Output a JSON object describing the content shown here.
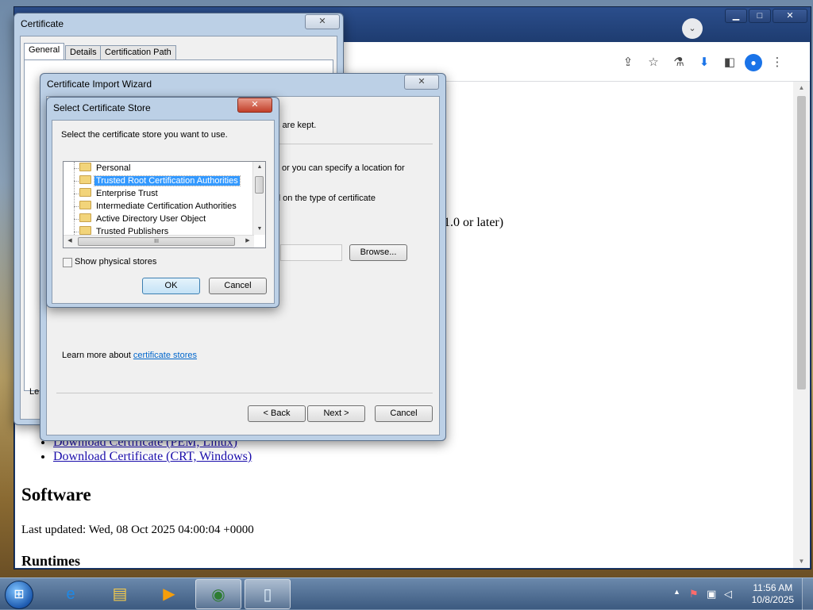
{
  "browser": {
    "page_fragment": "1.0 or later)",
    "links": [
      "Download Certificate (PEM, Linux)",
      "Download Certificate (CRT, Windows)"
    ],
    "heading_software": "Software",
    "last_updated": "Last updated: Wed, 08 Oct 2025 04:00:04 +0000",
    "heading_runtimes": "Runtimes",
    "window_buttons": {
      "minimize": "▁",
      "maximize": "□",
      "close": "✕"
    },
    "tab_dropdown": "⌄",
    "toolbar_icons": {
      "share": "⇪",
      "bookmark": "☆",
      "labs": "⚗",
      "download": "⬇",
      "sidepanel": "◧",
      "profile": "●",
      "menu": "⋮"
    }
  },
  "certificate_dialog": {
    "title": "Certificate",
    "close": "✕",
    "tabs": [
      "General",
      "Details",
      "Certification Path"
    ],
    "partial_text": "Le"
  },
  "import_wizard": {
    "title": "Certificate Import Wizard",
    "close": "✕",
    "text_fragment_1": "s are kept.",
    "text_fragment_2": "or you can specify a location for",
    "text_fragment_3": "d on the type of certificate",
    "browse_button": "Browse...",
    "learn_more_prefix": "Learn more about ",
    "learn_more_link": "certificate stores",
    "back_button": "< Back",
    "next_button": "Next >",
    "cancel_button": "Cancel"
  },
  "store_dialog": {
    "title": "Select Certificate Store",
    "close": "✕",
    "instruction": "Select the certificate store you want to use.",
    "stores": [
      "Personal",
      "Trusted Root Certification Authorities",
      "Enterprise Trust",
      "Intermediate Certification Authorities",
      "Active Directory User Object",
      "Trusted Publishers"
    ],
    "selected_store": "Trusted Root Certification Authorities",
    "show_physical_stores": "Show physical stores",
    "ok_button": "OK",
    "cancel_button": "Cancel",
    "scroll_up": "▲",
    "scroll_down": "▼",
    "scroll_left": "◀",
    "scroll_right": "▶",
    "hscroll_grip": "III"
  },
  "taskbar": {
    "start": "⊞",
    "time": "11:56 AM",
    "date": "10/8/2025",
    "tray_arrow": "▲",
    "apps": [
      "internet-explorer",
      "file-explorer",
      "media-player",
      "chrome",
      "document"
    ]
  },
  "colors": {
    "selection": "#3399ff",
    "link": "#1a0dab",
    "dialog_frame": "#bcd0e6",
    "taskbar": "#4b6a92"
  }
}
